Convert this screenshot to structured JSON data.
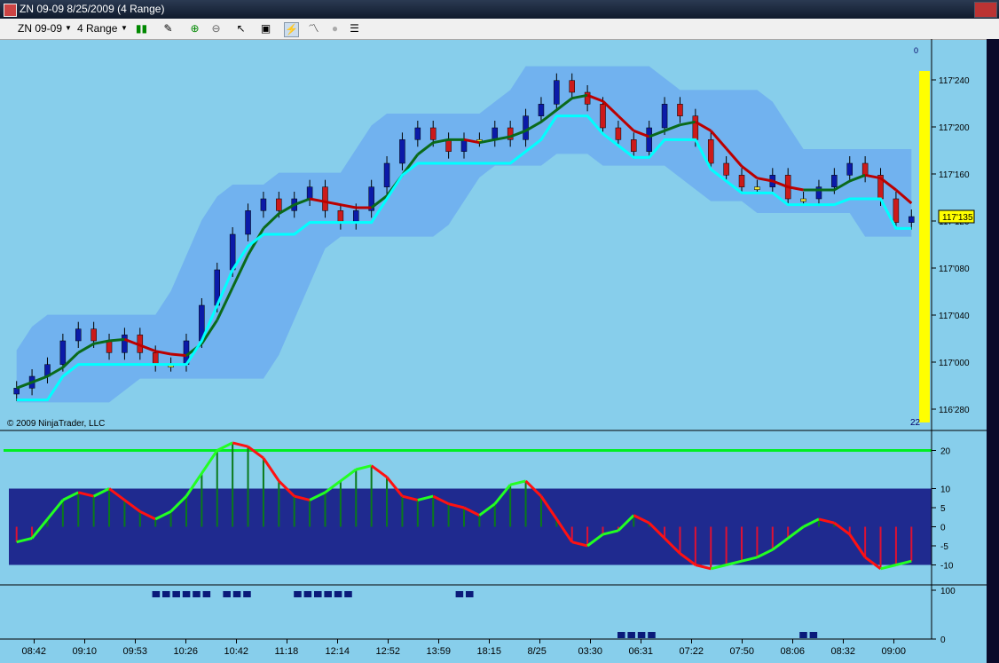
{
  "window": {
    "title": "ZN 09-09  8/25/2009 (4 Range)"
  },
  "toolbar": {
    "instrument": "ZN 09-09",
    "period": "4 Range"
  },
  "copyright": "© 2009 NinjaTrader, LLC",
  "colors": {
    "background": "#87ceeb",
    "band": "#6aa8f0",
    "up_bar": "#0b1aa8",
    "down_bar": "#cc1a1a",
    "neutral_bar": "#f0e430",
    "osc_box": "#1f2a8f",
    "level": "#00ee22",
    "price_marker": "#ffff00"
  },
  "price_marker": {
    "label": "117'135",
    "value": 117.135
  },
  "top_right": {
    "count_label": "22",
    "zero_label": "0"
  },
  "chart_data": [
    {
      "type": "candlestick",
      "title": "",
      "xlabel": "",
      "ylabel": "",
      "y_ticks": [
        117.28,
        117.24,
        117.2,
        117.16,
        117.12,
        117.08,
        117.04,
        117.0,
        116.96
      ],
      "y_tick_labels": [
        "116'280",
        "117'240",
        "117'200",
        "117'160",
        "117'120",
        "117'080",
        "117'040",
        "117'000",
        "116'280"
      ],
      "y_tick_labels_fixed": [
        "117'240",
        "117'200",
        "117'160",
        "117'120",
        "117'080",
        "117'040",
        "117'000",
        "116'280"
      ],
      "x_labels": [
        "08:42",
        "09:10",
        "09:53",
        "10:26",
        "10:42",
        "11:18",
        "12:14",
        "12:52",
        "13:59",
        "18:15",
        "8/25",
        "03:30",
        "06:31",
        "07:22",
        "07:50",
        "08:06",
        "08:32",
        "09:00"
      ],
      "ylim": [
        116.955,
        117.27
      ],
      "close": [
        116.99,
        117.0,
        117.01,
        117.03,
        117.04,
        117.03,
        117.02,
        117.035,
        117.02,
        117.01,
        117.01,
        117.03,
        117.06,
        117.09,
        117.12,
        117.14,
        117.15,
        117.14,
        117.15,
        117.16,
        117.14,
        117.13,
        117.14,
        117.16,
        117.18,
        117.2,
        117.21,
        117.2,
        117.19,
        117.2,
        117.2,
        117.21,
        117.2,
        117.22,
        117.23,
        117.25,
        117.24,
        117.23,
        117.21,
        117.2,
        117.19,
        117.21,
        117.23,
        117.22,
        117.2,
        117.18,
        117.17,
        117.16,
        117.16,
        117.17,
        117.15,
        117.15,
        117.16,
        117.17,
        117.18,
        117.17,
        117.15,
        117.13,
        117.135
      ],
      "series": [
        {
          "name": "",
          "type": "line",
          "values": []
        }
      ],
      "bands_note": ""
    },
    {
      "type": "oscillator",
      "y_ticks": [
        20,
        10,
        5,
        0,
        -5,
        -10
      ],
      "y_tick_labels": [
        "20",
        "10",
        "5",
        "0",
        "-5",
        "-10"
      ],
      "levels": [
        20,
        10,
        -10
      ],
      "values": [
        -4,
        -3,
        2,
        7,
        9,
        8,
        10,
        7,
        4,
        2,
        4,
        8,
        14,
        20,
        22,
        21,
        18,
        12,
        8,
        7,
        9,
        12,
        15,
        16,
        13,
        8,
        7,
        8,
        6,
        5,
        3,
        6,
        11,
        12,
        8,
        2,
        -4,
        -5,
        -2,
        -1,
        3,
        1,
        -3,
        -7,
        -10,
        -11,
        -10,
        -9,
        -8,
        -6,
        -3,
        0,
        2,
        1,
        -2,
        -8,
        -11,
        -10,
        -9
      ]
    },
    {
      "type": "bars",
      "y_ticks": [
        100,
        0
      ],
      "y_tick_labels": [
        "100",
        "0"
      ],
      "segments": [
        {
          "start": 14,
          "end": 19,
          "level": 100
        },
        {
          "start": 21,
          "end": 23,
          "level": 100
        },
        {
          "start": 28,
          "end": 33,
          "level": 100
        },
        {
          "start": 44,
          "end": 45,
          "level": 100
        },
        {
          "start": 60,
          "end": 63,
          "level": 0
        },
        {
          "start": 78,
          "end": 79,
          "level": 0
        }
      ]
    }
  ]
}
